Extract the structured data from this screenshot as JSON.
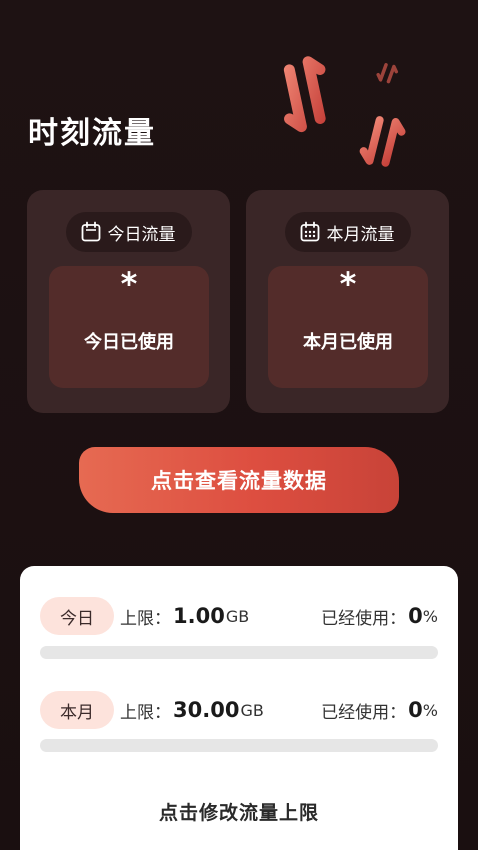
{
  "header": {
    "title": "时刻流量"
  },
  "cards": {
    "today": {
      "chip_label": "今日流量",
      "value": "*",
      "caption": "今日已使用",
      "icon": "calendar-icon"
    },
    "month": {
      "chip_label": "本月流量",
      "value": "*",
      "caption": "本月已使用",
      "icon": "calendar-month-icon"
    }
  },
  "cta": {
    "label": "点击查看流量数据"
  },
  "limits": {
    "today": {
      "badge": "今日",
      "limit_label": "上限：",
      "limit_value": "1.00",
      "limit_unit": "GB",
      "used_label": "已经使用：",
      "used_value": "0",
      "used_unit": "%",
      "progress_percent": 0
    },
    "month": {
      "badge": "本月",
      "limit_label": "上限：",
      "limit_value": "30.00",
      "limit_unit": "GB",
      "used_label": "已经使用：",
      "used_value": "0",
      "used_unit": "%",
      "progress_percent": 0
    },
    "modify_label": "点击修改流量上限"
  },
  "colors": {
    "accent": "#e0574a",
    "background": "#1c1012",
    "card": "#3a2627",
    "card_inner": "#532c2a",
    "badge_bg": "#fde3dc"
  }
}
